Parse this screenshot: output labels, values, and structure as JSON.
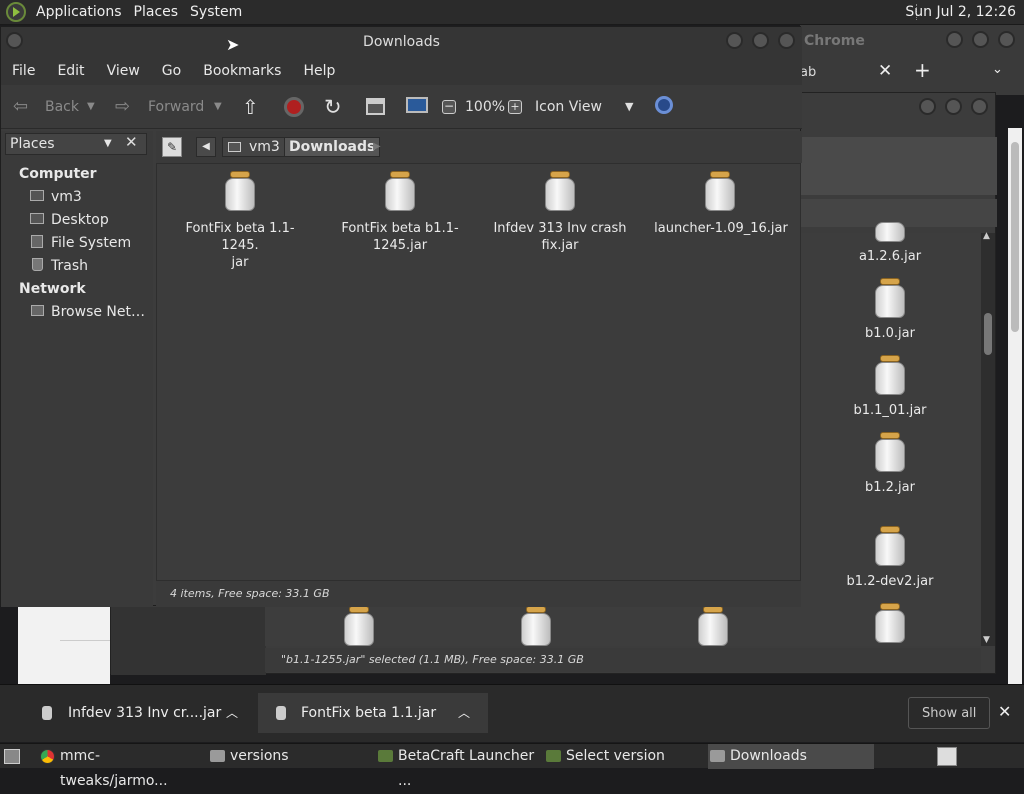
{
  "top_panel": {
    "menus": [
      "Applications",
      "Places",
      "System"
    ],
    "clock": "Sun Jul  2, 12:26"
  },
  "chrome_window": {
    "title": "Chrome",
    "tab_fragment": "ab"
  },
  "main_window": {
    "title": "Downloads",
    "menu": [
      "File",
      "Edit",
      "View",
      "Go",
      "Bookmarks",
      "Help"
    ],
    "toolbar": {
      "back": "Back",
      "forward": "Forward",
      "zoom": "100%",
      "view_mode": "Icon View"
    },
    "sidebar": {
      "selector": "Places",
      "sections": [
        {
          "heading": "Computer",
          "items": [
            "vm3",
            "Desktop",
            "File System",
            "Trash"
          ]
        },
        {
          "heading": "Network",
          "items": [
            "Browse Net…"
          ]
        }
      ]
    },
    "path": [
      "vm3",
      "Downloads"
    ],
    "files": [
      "FontFix beta 1.1-1245.\njar",
      "FontFix beta b1.1-\n1245.jar",
      "Infdev 313 Inv crash\nfix.jar",
      "launcher-1.09_16.jar"
    ],
    "status": "4 items, Free space: 33.1 GB"
  },
  "back_window": {
    "files": [
      "a1.2.6.jar",
      "b1.0.jar",
      "b1.1_01.jar",
      "b1.2.jar",
      "b1.2-dev2.jar"
    ],
    "status": "\"b1.1-1255.jar\" selected (1.1 MB), Free space: 33.1 GB"
  },
  "downloads_bar": {
    "items": [
      "Infdev 313 Inv cr....jar",
      "FontFix beta 1.1.jar"
    ],
    "show_all": "Show all"
  },
  "taskbar": {
    "tasks": [
      "mmc-tweaks/jarmo...",
      "versions",
      "BetaCraft Launcher ...",
      "Select version",
      "Downloads"
    ]
  }
}
